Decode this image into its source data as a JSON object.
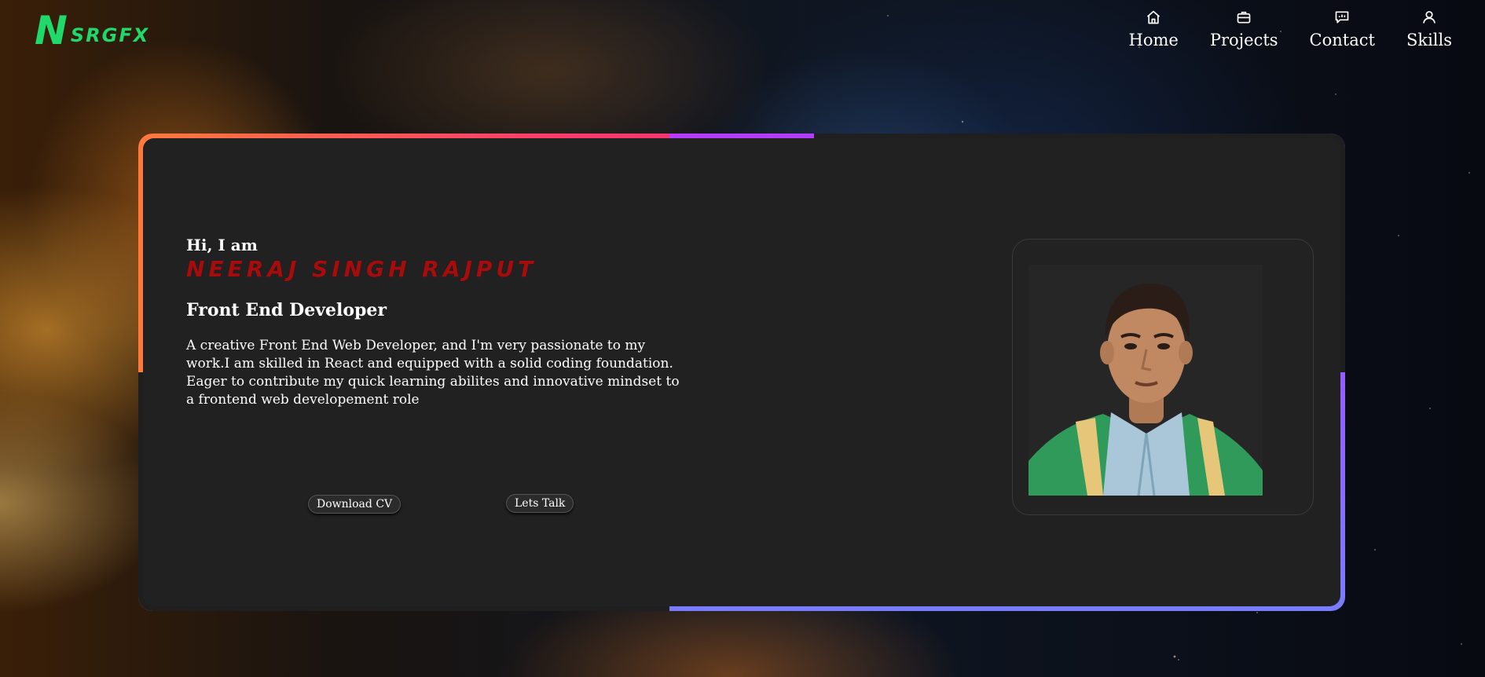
{
  "brand": {
    "logo_initial": "N",
    "logo_rest": "SRGFX",
    "color": "#1fd96a"
  },
  "nav": {
    "items": [
      {
        "label": "Home",
        "icon": "home-icon"
      },
      {
        "label": "Projects",
        "icon": "briefcase-icon"
      },
      {
        "label": "Contact",
        "icon": "chat-icon"
      },
      {
        "label": "Skills",
        "icon": "user-icon"
      }
    ]
  },
  "hero": {
    "greeting": "Hi, I am",
    "name": "NEERAJ SINGH RAJPUT",
    "name_color": "#a30d0d",
    "role": "Front End Developer",
    "description": "A creative Front End Web Developer, and I'm very passionate to my work.I am skilled in React and equipped with a solid coding foundation. Eager to contribute my quick learning abilites and innovative mindset to a frontend web developement role",
    "buttons": {
      "download_cv": "Download CV",
      "lets_talk": "Lets Talk"
    }
  },
  "colors": {
    "card_bg": "#212121",
    "accent_top_start": "#ff7a3d",
    "accent_top_end": "#e0306e",
    "accent_bottom_start": "#b33cff",
    "accent_bottom_end": "#7a7cff"
  }
}
